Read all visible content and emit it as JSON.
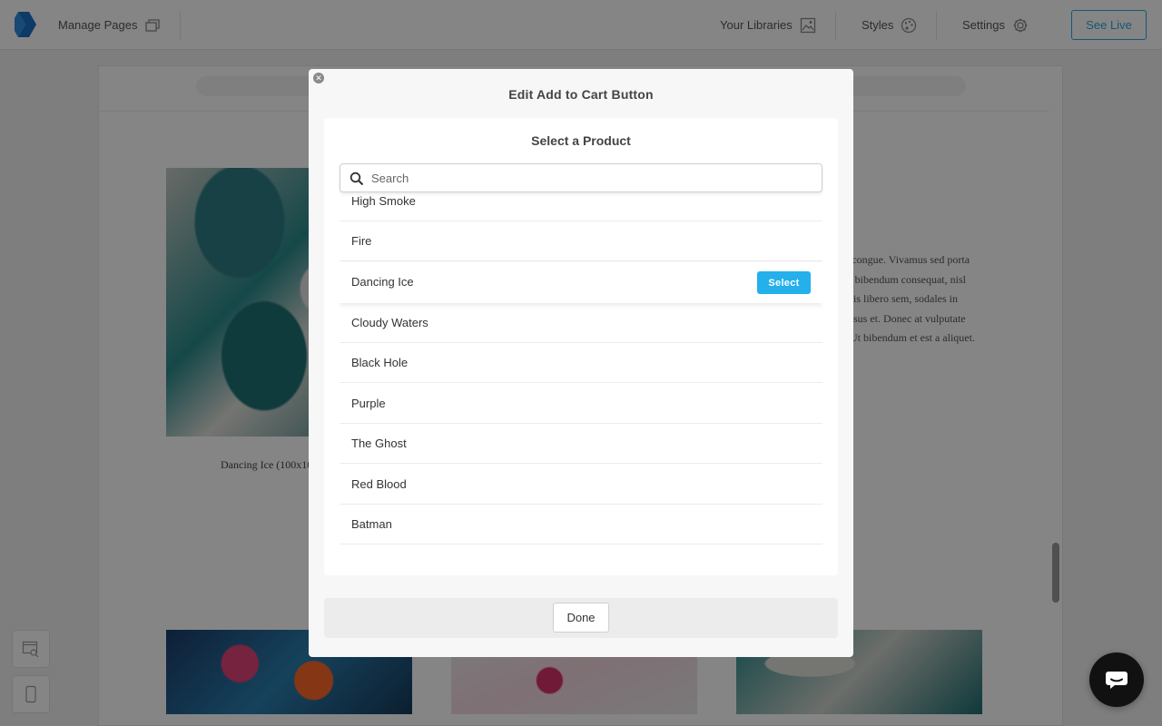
{
  "topbar": {
    "manage_pages": "Manage Pages",
    "your_libraries": "Your Libraries",
    "styles": "Styles",
    "settings": "Settings",
    "see_live": "See Live",
    "accent_color": "#2aa8e0"
  },
  "background_page": {
    "caption": "Dancing Ice (100x10",
    "lorem_lines": [
      "a congue. Vivamus sed porta",
      "et bibendum consequat, nisl",
      "uris libero sem, sodales in",
      "ursus et. Donec at vulputate",
      ". Ut bibendum et est a aliquet."
    ]
  },
  "modal": {
    "title": "Edit Add to Cart Button",
    "panel_title": "Select a Product",
    "search": {
      "placeholder": "Search",
      "value": ""
    },
    "products": [
      {
        "name": "High Smoke"
      },
      {
        "name": "Fire"
      },
      {
        "name": "Dancing Ice",
        "hovered": true
      },
      {
        "name": "Cloudy Waters"
      },
      {
        "name": "Black Hole"
      },
      {
        "name": "Purple"
      },
      {
        "name": "The Ghost"
      },
      {
        "name": "Red Blood"
      },
      {
        "name": "Batman"
      }
    ],
    "select_label": "Select",
    "select_color": "#23b0eb",
    "done_label": "Done"
  }
}
